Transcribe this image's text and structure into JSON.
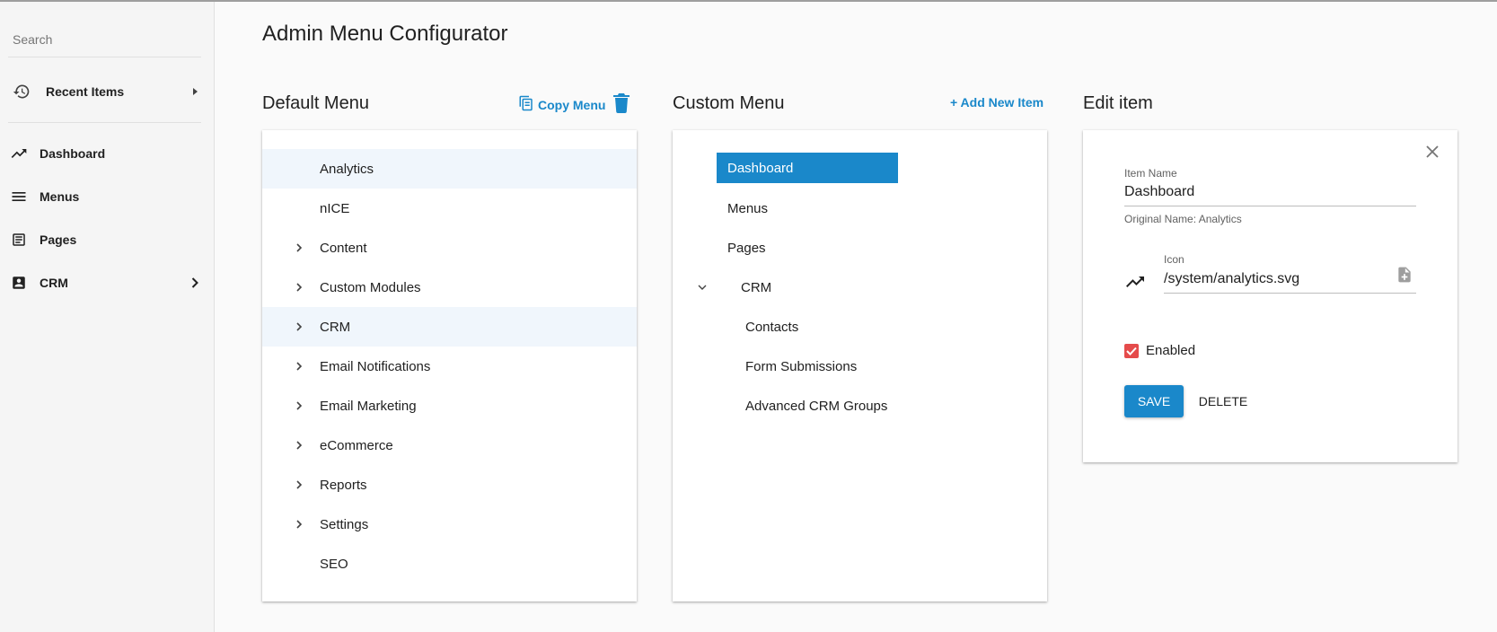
{
  "sidebar": {
    "search_placeholder": "Search",
    "recent_label": "Recent Items",
    "items": [
      {
        "label": "Dashboard",
        "icon": "trending-up-icon"
      },
      {
        "label": "Menus",
        "icon": "menu-icon"
      },
      {
        "label": "Pages",
        "icon": "page-icon"
      },
      {
        "label": "CRM",
        "icon": "contact-card-icon"
      }
    ]
  },
  "page_title": "Admin Menu Configurator",
  "default_menu": {
    "title": "Default Menu",
    "copy_label": "Copy Menu",
    "items": [
      {
        "label": "Analytics",
        "expandable": false
      },
      {
        "label": "nICE",
        "expandable": false
      },
      {
        "label": "Content",
        "expandable": true
      },
      {
        "label": "Custom Modules",
        "expandable": true
      },
      {
        "label": "CRM",
        "expandable": true
      },
      {
        "label": "Email Notifications",
        "expandable": true
      },
      {
        "label": "Email Marketing",
        "expandable": true
      },
      {
        "label": "eCommerce",
        "expandable": true
      },
      {
        "label": "Reports",
        "expandable": true
      },
      {
        "label": "Settings",
        "expandable": true
      },
      {
        "label": "SEO",
        "expandable": false
      }
    ]
  },
  "custom_menu": {
    "title": "Custom Menu",
    "add_label": "+ Add New Item",
    "items": [
      {
        "label": "Dashboard",
        "selected": true
      },
      {
        "label": "Menus"
      },
      {
        "label": "Pages"
      },
      {
        "label": "CRM",
        "expanded": true
      },
      {
        "label": "Contacts",
        "child": true
      },
      {
        "label": "Form Submissions",
        "child": true
      },
      {
        "label": "Advanced CRM Groups",
        "child": true
      }
    ]
  },
  "edit_item": {
    "title": "Edit item",
    "item_name_label": "Item Name",
    "item_name_value": "Dashboard",
    "original_name": "Original Name: Analytics",
    "icon_label": "Icon",
    "icon_value": "/system/analytics.svg",
    "enabled_label": "Enabled",
    "enabled": true,
    "save_label": "SAVE",
    "delete_label": "DELETE"
  },
  "colors": {
    "accent": "#1a88ca",
    "checkbox": "#e54b4b",
    "highlight": "#f0f6fc"
  }
}
